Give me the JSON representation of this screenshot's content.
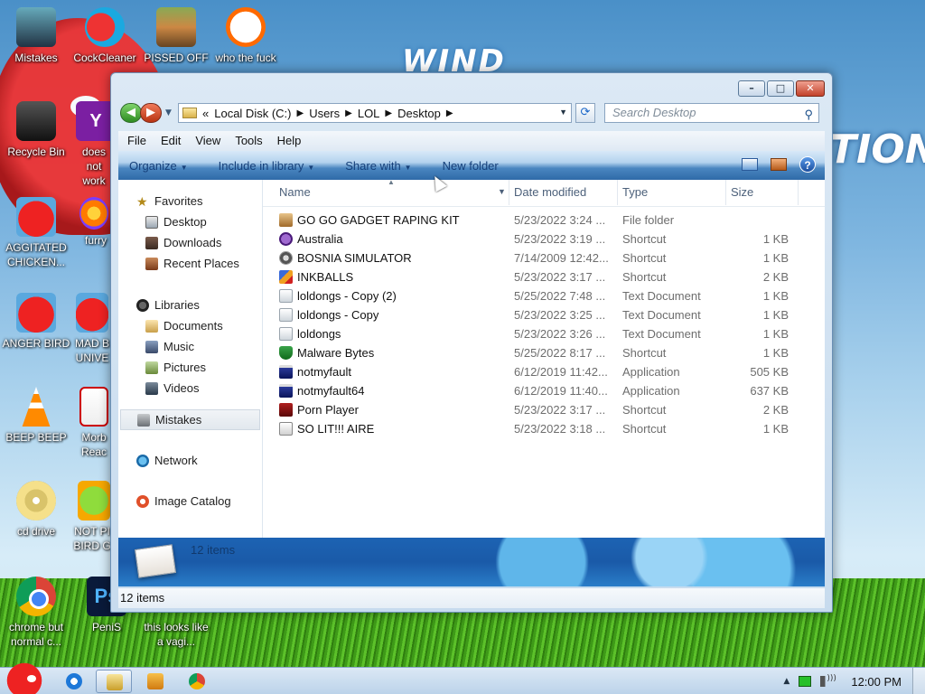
{
  "desktop": {
    "wallpaper_text": [
      "WIND",
      "TION"
    ],
    "icons": [
      {
        "label": "Mistakes",
        "icon": "computer-icon"
      },
      {
        "label": "CockCleaner",
        "icon": "ccleaner-icon"
      },
      {
        "label": "PISSED OFF",
        "icon": "game-icon"
      },
      {
        "label": "who the fuck",
        "icon": "flash-icon"
      },
      {
        "label": "Recycle Bin",
        "icon": "recycle-bin-icon"
      },
      {
        "label": "does not work",
        "icon": "yahoo-icon"
      },
      {
        "label": "AGGITATED CHICKEN...",
        "icon": "angry-bird-icon"
      },
      {
        "label": "furry",
        "icon": "firefox-icon"
      },
      {
        "label": "ANGER BIRD",
        "icon": "angry-bird-icon"
      },
      {
        "label": "MAD B UNIVE",
        "icon": "angry-bird-space-icon"
      },
      {
        "label": "BEEP BEEP",
        "icon": "vlc-icon"
      },
      {
        "label": "Morb Reac",
        "icon": "pdf-icon"
      },
      {
        "label": "cd drive",
        "icon": "cd-icon"
      },
      {
        "label": "NOT PI BIRD G",
        "icon": "pig-icon"
      },
      {
        "label": "chrome but normal c...",
        "icon": "chrome-icon"
      },
      {
        "label": "PeniS",
        "icon": "photoshop-icon"
      },
      {
        "label": "this looks like a vagi...",
        "icon": "shortcut-icon"
      }
    ]
  },
  "explorer": {
    "address": {
      "prefix": "«",
      "crumbs": [
        "Local Disk (C:)",
        "Users",
        "LOL",
        "Desktop"
      ]
    },
    "search_placeholder": "Search Desktop",
    "menu": [
      "File",
      "Edit",
      "View",
      "Tools",
      "Help"
    ],
    "toolbar": [
      "Organize",
      "Include in library",
      "Share with",
      "New folder"
    ],
    "nav": {
      "favorites_label": "Favorites",
      "favorites": [
        "Desktop",
        "Downloads",
        "Recent Places"
      ],
      "libraries_label": "Libraries",
      "libraries": [
        "Documents",
        "Music",
        "Pictures",
        "Videos"
      ],
      "selected": "Mistakes",
      "network": "Network",
      "image_catalog": "Image Catalog"
    },
    "columns": {
      "name": "Name",
      "date": "Date modified",
      "type": "Type",
      "size": "Size"
    },
    "files": [
      {
        "name": "GO GO GADGET RAPING KIT",
        "date": "5/23/2022 3:24 ...",
        "type": "File folder",
        "size": "",
        "icon": "folder-icon"
      },
      {
        "name": "Australia",
        "date": "5/23/2022 3:19 ...",
        "type": "Shortcut",
        "size": "1 KB",
        "icon": "shortcut-icon"
      },
      {
        "name": "BOSNIA SIMULATOR",
        "date": "7/14/2009 12:42...",
        "type": "Shortcut",
        "size": "1 KB",
        "icon": "shortcut-icon"
      },
      {
        "name": "INKBALLS",
        "date": "5/23/2022 3:17 ...",
        "type": "Shortcut",
        "size": "2 KB",
        "icon": "shortcut-icon"
      },
      {
        "name": "loldongs - Copy (2)",
        "date": "5/25/2022 7:48 ...",
        "type": "Text Document",
        "size": "1 KB",
        "icon": "text-document-icon"
      },
      {
        "name": "loldongs - Copy",
        "date": "5/23/2022 3:25 ...",
        "type": "Text Document",
        "size": "1 KB",
        "icon": "text-document-icon"
      },
      {
        "name": "loldongs",
        "date": "5/23/2022 3:26 ...",
        "type": "Text Document",
        "size": "1 KB",
        "icon": "text-document-icon"
      },
      {
        "name": "Malware Bytes",
        "date": "5/25/2022 8:17 ...",
        "type": "Shortcut",
        "size": "1 KB",
        "icon": "shield-icon"
      },
      {
        "name": "notmyfault",
        "date": "6/12/2019 11:42...",
        "type": "Application",
        "size": "505 KB",
        "icon": "application-icon"
      },
      {
        "name": "notmyfault64",
        "date": "6/12/2019 11:40...",
        "type": "Application",
        "size": "637 KB",
        "icon": "application-icon"
      },
      {
        "name": "Porn Player",
        "date": "5/23/2022 3:17 ...",
        "type": "Shortcut",
        "size": "2 KB",
        "icon": "flash-player-icon"
      },
      {
        "name": "SO LIT!!! AIRE",
        "date": "5/23/2022 3:18 ...",
        "type": "Shortcut",
        "size": "1 KB",
        "icon": "shortcut-icon"
      }
    ],
    "details_count": "12 items",
    "status_count": "12 items"
  },
  "taskbar": {
    "clock": "12:00 PM"
  }
}
